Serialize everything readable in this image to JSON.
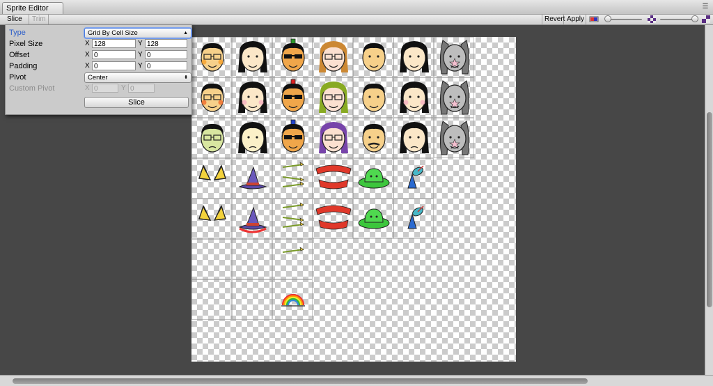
{
  "window": {
    "title": "Sprite Editor"
  },
  "toolbar": {
    "slice_label": "Slice ⬍",
    "trim_label": "Trim",
    "revert_label": "Revert",
    "apply_label": "Apply"
  },
  "panel": {
    "type": {
      "label": "Type",
      "value": "Grid By Cell Size"
    },
    "pixel_size": {
      "label": "Pixel Size",
      "x_label": "X",
      "x": "128",
      "y_label": "Y",
      "y": "128"
    },
    "offset": {
      "label": "Offset",
      "x_label": "X",
      "x": "0",
      "y_label": "Y",
      "y": "0"
    },
    "padding": {
      "label": "Padding",
      "x_label": "X",
      "x": "0",
      "y_label": "Y",
      "y": "0"
    },
    "pivot": {
      "label": "Pivot",
      "value": "Center"
    },
    "custom_pivot": {
      "label": "Custom Pivot",
      "x_label": "X",
      "x": "0",
      "y_label": "Y",
      "y": "0"
    },
    "slice_button": "Slice"
  },
  "sprite_sheet": {
    "grid_columns": 8,
    "grid_rows": 8,
    "rows": [
      [
        "face-glasses",
        "face-longhair-girl",
        "face-mohawk-green",
        "face-redhair-girl",
        "face-man-smile",
        "face-longhair-woman",
        "face-bunny"
      ],
      [
        "face-glasses-blush",
        "face-longhair-girl-blush",
        "face-mohawk-red",
        "face-redhair-girl-2",
        "face-man-wink",
        "face-longhair-woman-blush",
        "face-bunny-2"
      ],
      [
        "face-glasses-sick",
        "face-longhair-girl-sad",
        "face-mohawk-blue",
        "face-girl-purple",
        "face-man-mustache",
        "face-longhair-woman-sleepy",
        "face-bunny-3"
      ],
      [
        "cat-ears",
        "witch-hat",
        "arrows",
        "red-scarf",
        "green-hat",
        "dish-antenna"
      ],
      [
        "cat-ears-2",
        "witch-hat-2",
        "arrows-2",
        "red-scarf-2",
        "green-hat-2",
        "dish-antenna-2"
      ],
      [
        "",
        "",
        "rainbow-arrows"
      ],
      [
        "",
        "",
        "rainbow"
      ]
    ]
  },
  "colors": {
    "accent": "#2e5fc9",
    "panel_bg": "#cbcbcb",
    "canvas_bg": "#474747"
  }
}
